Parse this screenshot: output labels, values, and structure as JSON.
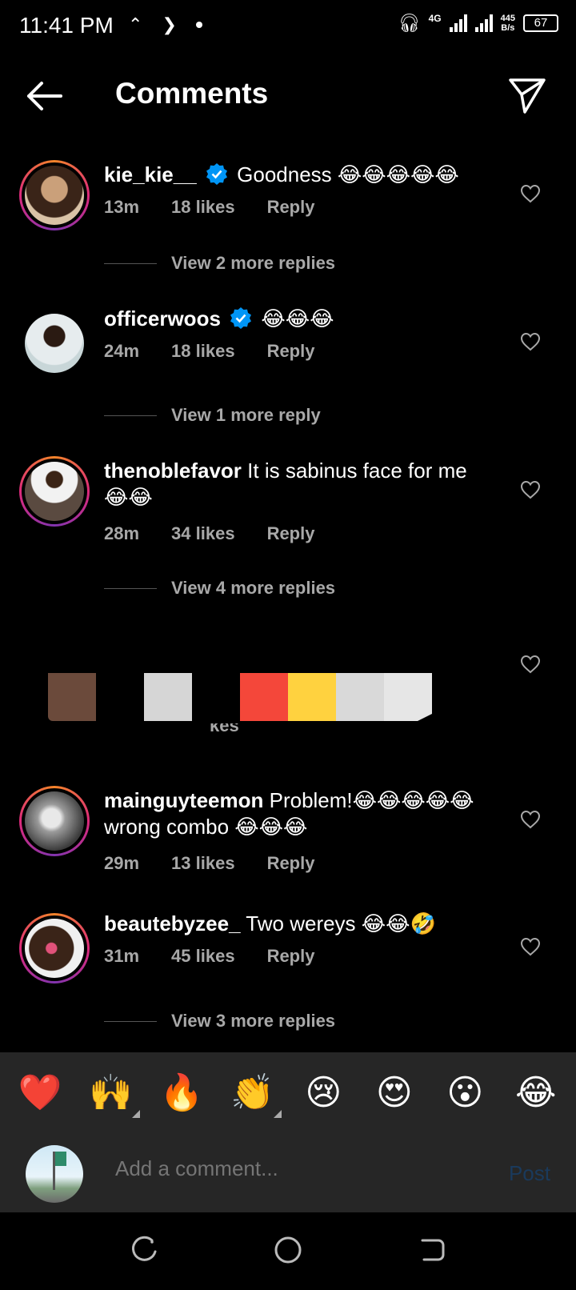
{
  "status": {
    "time": "11:41 PM",
    "network": "4G",
    "speed_value": "445",
    "speed_unit": "B/s",
    "battery": "67"
  },
  "header": {
    "title": "Comments"
  },
  "comments": [
    {
      "username": "kie_kie__",
      "verified": true,
      "text": "Goodness 😂😂😂😂😂",
      "time": "13m",
      "likes": "18 likes",
      "reply": "Reply",
      "view_replies": "View 2 more replies"
    },
    {
      "username": "officerwoos",
      "verified": true,
      "text": "😂😂😂",
      "time": "24m",
      "likes": "18 likes",
      "reply": "Reply",
      "view_replies": "View 1 more reply"
    },
    {
      "username": "thenoblefavor",
      "verified": false,
      "text": "It is sabinus face for me 😂😂",
      "time": "28m",
      "likes": "34 likes",
      "reply": "Reply",
      "view_replies": "View 4 more replies"
    },
    {
      "username": "mainguyteemon",
      "verified": false,
      "text": "Problem!😂😂😂😂😂 wrong combo 😂😂😂",
      "time": "29m",
      "likes": "13 likes",
      "reply": "Reply"
    },
    {
      "username": "beautebyzee_",
      "verified": false,
      "text": "Two wereys 😂😂🤣",
      "time": "31m",
      "likes": "45 likes",
      "reply": "Reply",
      "view_replies": "View 3 more replies"
    }
  ],
  "redacted_fragment": "kes",
  "emoji_bar": [
    "❤️",
    "🙌",
    "🔥",
    "👏",
    "😢",
    "😍",
    "😮",
    "😂"
  ],
  "composer": {
    "placeholder": "Add a comment...",
    "post_label": "Post"
  },
  "colors": {
    "background": "#000000",
    "panel": "#262626",
    "muted_text": "#a8a8a8",
    "verified_blue": "#0095f6",
    "post_disabled": "#1a3a5c"
  }
}
